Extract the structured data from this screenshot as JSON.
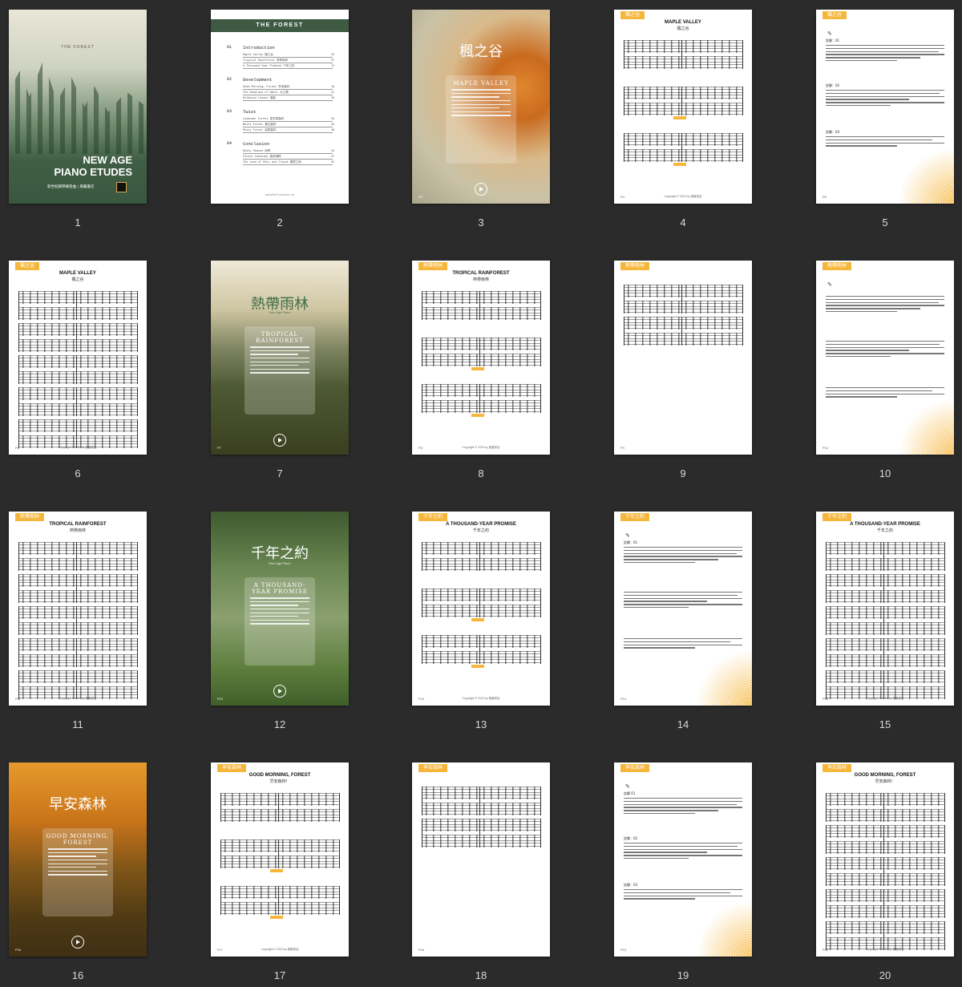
{
  "pages": [
    {
      "n": "1",
      "kind": "cover",
      "brand": "THE FOREST",
      "title1": "NEW AGE",
      "title2": "PIANO ETUDES",
      "subtitle": "新世紀鋼琴練習曲 | 風籟書店"
    },
    {
      "n": "2",
      "kind": "toc",
      "header": "THE FOREST",
      "footer": "windfallstudio.tw",
      "sections": [
        {
          "no": "01",
          "name": "Introduction",
          "items": [
            {
              "t": "Maple Valley 楓之谷",
              "p": "03"
            },
            {
              "t": "Tropical Rainforest 熱帶雨林",
              "p": "07"
            },
            {
              "t": "A Thousand-Year Promise 千年之約",
              "p": "12"
            }
          ]
        },
        {
          "no": "02",
          "name": "Development",
          "items": [
            {
              "t": "Good Morning, Forest 早安森林",
              "p": "16"
            },
            {
              "t": "The Homeland of Water 水之鄉",
              "p": "21"
            },
            {
              "t": "Wildwood Leaves 落葉",
              "p": "26"
            }
          ]
        },
        {
          "no": "03",
          "name": "Twist",
          "items": [
            {
              "t": "Lavender Forest 薰衣草森林",
              "p": "30"
            },
            {
              "t": "White Forest 雪白森林",
              "p": "34"
            },
            {
              "t": "Misty Forest 迷霧森林",
              "p": "38"
            }
          ]
        },
        {
          "no": "04",
          "name": "Conclusion",
          "items": [
            {
              "t": "Rainy Season 雨季",
              "p": "43"
            },
            {
              "t": "Forest Lakeside 森林湖畔",
              "p": "47"
            },
            {
              "t": "The Land of Mist and Clouds 雲霧之地",
              "p": "51"
            }
          ]
        }
      ]
    },
    {
      "n": "3",
      "kind": "photo",
      "cjk": "楓之谷",
      "box_title": "MAPLE VALLEY",
      "pnum": "P3"
    },
    {
      "n": "4",
      "kind": "score",
      "tag": "楓之谷",
      "title": "MAPLE VALLEY",
      "sub": "楓之谷",
      "pnum": "P4",
      "foot": "Copyright © 2023 by 風籟書店"
    },
    {
      "n": "5",
      "kind": "notes",
      "tag": "楓之谷",
      "pnum": "P5",
      "h1": "註解：01",
      "h2": "註解：02",
      "h3": "註解：03"
    },
    {
      "n": "6",
      "kind": "score",
      "tag": "楓之谷",
      "title": "MAPLE VALLEY",
      "sub": "楓之谷",
      "pnum": "P6",
      "foot": "Copyright © 2023 by 風籟書店"
    },
    {
      "n": "7",
      "kind": "photo",
      "cjk": "熱帶雨林",
      "box_title": "TROPICAL RAINFOREST",
      "sub_en": "New Age Piano",
      "pnum": "P7"
    },
    {
      "n": "8",
      "kind": "score",
      "tag": "熱帶雨林",
      "title": "TROPICAL RAINFOREST",
      "sub": "熱帶雨林",
      "pnum": "P8",
      "foot": "Copyright © 2023 by 風籟書店"
    },
    {
      "n": "9",
      "kind": "score-short",
      "tag": "熱帶雨林",
      "pnum": "P9"
    },
    {
      "n": "10",
      "kind": "notes",
      "tag": "熱帶雨林",
      "pnum": "P10"
    },
    {
      "n": "11",
      "kind": "score",
      "tag": "熱帶雨林",
      "title": "TROPICAL RAINFOREST",
      "sub": "熱帶雨林",
      "pnum": "P11",
      "foot": "Copyright © 2023 by 風籟書店"
    },
    {
      "n": "12",
      "kind": "photo",
      "cjk": "千年之約",
      "box_title": "A THOUSAND-YEAR PROMISE",
      "sub_en": "New Age Piano",
      "pnum": "P12"
    },
    {
      "n": "13",
      "kind": "score",
      "tag": "千年之約",
      "title": "A THOUSAND-YEAR PROMISE",
      "sub": "千年之約",
      "pnum": "P13",
      "foot": "Copyright © 2023 by 風籟書店"
    },
    {
      "n": "14",
      "kind": "notes",
      "tag": "千年之約",
      "pnum": "P14",
      "h1": "註解：01"
    },
    {
      "n": "15",
      "kind": "score",
      "tag": "千年之約",
      "title": "A THOUSAND-YEAR PROMISE",
      "sub": "千年之約",
      "pnum": "P15",
      "foot": "Copyright © 2023 by 風籟書店"
    },
    {
      "n": "16",
      "kind": "photo",
      "cjk": "早安森林",
      "box_title": "GOOD MORNING, FOREST",
      "pnum": "P16"
    },
    {
      "n": "17",
      "kind": "score",
      "tag": "早安森林",
      "title": "GOOD MORNING, FOREST",
      "sub": "早安森林！",
      "pnum": "P17",
      "foot": "Copyright © 2023 by 風籟書店"
    },
    {
      "n": "18",
      "kind": "score-short",
      "tag": "早安森林",
      "pnum": "P18"
    },
    {
      "n": "19",
      "kind": "notes",
      "tag": "早安森林",
      "pnum": "P19",
      "h1": "註解 01",
      "h2": "註解：02",
      "h3": "註解：03"
    },
    {
      "n": "20",
      "kind": "score",
      "tag": "早安森林",
      "title": "GOOD MORNING, FOREST",
      "sub": "早安森林！",
      "pnum": "P20",
      "foot": "Copyright © 2023 by 風籟書店"
    }
  ],
  "colors": {
    "background": "#2b2b2b",
    "tag": "#f6b63c",
    "forest_green": "#3f5e44",
    "toc_header": "#3e5a43"
  }
}
